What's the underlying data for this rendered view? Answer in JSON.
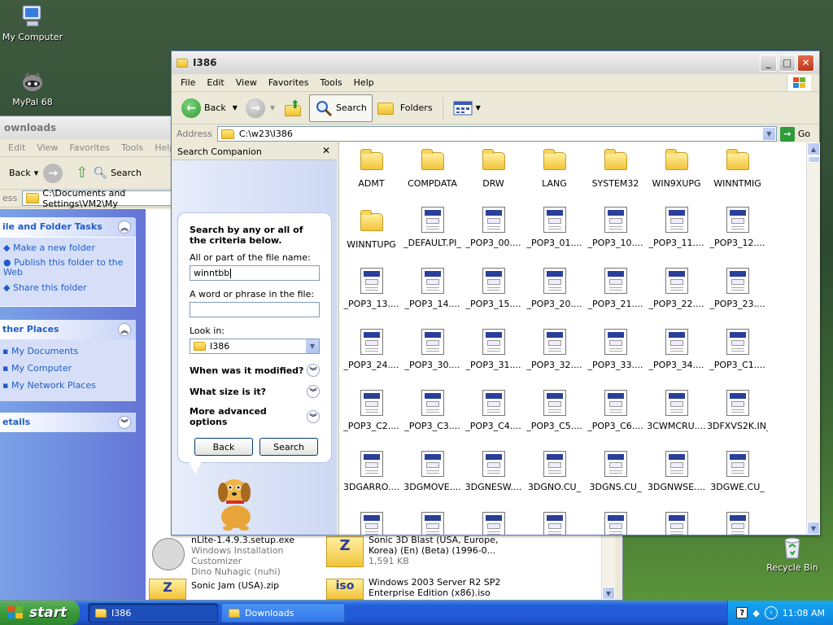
{
  "desktop": {
    "icons": [
      {
        "label": "My Computer"
      },
      {
        "label": "MyPal 68"
      },
      {
        "label": "Recycle Bin"
      }
    ]
  },
  "downloads_window": {
    "title": "ownloads",
    "menu": [
      "Edit",
      "View",
      "Favorites",
      "Tools",
      "Help"
    ],
    "toolbar": {
      "back": "Back",
      "search": "Search"
    },
    "address": "C:\\Documents and Settings\\VM2\\My",
    "address_label": "ess",
    "tasks": {
      "header": "ile and Folder Tasks",
      "items": [
        "Make a new folder",
        "Publish this folder to the Web",
        "Share this folder"
      ]
    },
    "other_places": {
      "header": "ther Places",
      "items": [
        "My Documents",
        "My Computer",
        "My Network Places"
      ]
    },
    "details": {
      "header": "etails"
    },
    "files": [
      {
        "name": "nLite-1.4.9.3.setup.exe",
        "line2": "Windows Installation Customizer",
        "line3": "Dino Nuhagic (nuhi)"
      },
      {
        "name": "Sonic 3D Blast (USA, Europe, Korea) (En) (Beta) (1996-0...",
        "line2": "",
        "line3": "1,591 KB"
      },
      {
        "name": "Sonic Jam (USA).zip",
        "line2": "",
        "line3": ""
      },
      {
        "name": "Windows 2003 Server R2 SP2 Enterprise Edition (x86).iso",
        "line2": "",
        "line3": ""
      }
    ]
  },
  "main_window": {
    "title": "I386",
    "menu": [
      "File",
      "Edit",
      "View",
      "Favorites",
      "Tools",
      "Help"
    ],
    "toolbar": {
      "back": "Back",
      "search": "Search",
      "folders": "Folders"
    },
    "address_label": "Address",
    "address": "C:\\w23\\I386",
    "go": "Go",
    "search_companion": {
      "title": "Search Companion",
      "heading": "Search by any or all of the criteria below.",
      "name_label": "All or part of the file name:",
      "name_value": "winntbb",
      "phrase_label": "A word or phrase in the file:",
      "phrase_value": "",
      "lookin_label": "Look in:",
      "lookin_value": "I386",
      "options": [
        "When was it modified?",
        "What size is it?",
        "More advanced options"
      ],
      "back_button": "Back",
      "search_button": "Search"
    },
    "items": [
      {
        "name": "ADMT",
        "type": "folder"
      },
      {
        "name": "COMPDATA",
        "type": "folder"
      },
      {
        "name": "DRW",
        "type": "folder"
      },
      {
        "name": "LANG",
        "type": "folder"
      },
      {
        "name": "SYSTEM32",
        "type": "folder"
      },
      {
        "name": "WIN9XUPG",
        "type": "folder"
      },
      {
        "name": "WINNTMIG",
        "type": "folder"
      },
      {
        "name": "WINNTUPG",
        "type": "folder"
      },
      {
        "name": "_DEFAULT.PI_",
        "type": "file"
      },
      {
        "name": "_POP3_00....",
        "type": "file"
      },
      {
        "name": "_POP3_01....",
        "type": "file"
      },
      {
        "name": "_POP3_10....",
        "type": "file"
      },
      {
        "name": "_POP3_11....",
        "type": "file"
      },
      {
        "name": "_POP3_12....",
        "type": "file"
      },
      {
        "name": "_POP3_13....",
        "type": "file"
      },
      {
        "name": "_POP3_14....",
        "type": "file"
      },
      {
        "name": "_POP3_15....",
        "type": "file"
      },
      {
        "name": "_POP3_20....",
        "type": "file"
      },
      {
        "name": "_POP3_21....",
        "type": "file"
      },
      {
        "name": "_POP3_22....",
        "type": "file"
      },
      {
        "name": "_POP3_23....",
        "type": "file"
      },
      {
        "name": "_POP3_24....",
        "type": "file"
      },
      {
        "name": "_POP3_30....",
        "type": "file"
      },
      {
        "name": "_POP3_31....",
        "type": "file"
      },
      {
        "name": "_POP3_32....",
        "type": "file"
      },
      {
        "name": "_POP3_33....",
        "type": "file"
      },
      {
        "name": "_POP3_34....",
        "type": "file"
      },
      {
        "name": "_POP3_C1....",
        "type": "file"
      },
      {
        "name": "_POP3_C2....",
        "type": "file"
      },
      {
        "name": "_POP3_C3....",
        "type": "file"
      },
      {
        "name": "_POP3_C4....",
        "type": "file"
      },
      {
        "name": "_POP3_C5....",
        "type": "file"
      },
      {
        "name": "_POP3_C6....",
        "type": "file"
      },
      {
        "name": "3CWMCRU....",
        "type": "file"
      },
      {
        "name": "3DFXVS2K.IN_",
        "type": "file"
      },
      {
        "name": "3DGARRO....",
        "type": "file"
      },
      {
        "name": "3DGMOVE....",
        "type": "file"
      },
      {
        "name": "3DGNESW....",
        "type": "file"
      },
      {
        "name": "3DGNO.CU_",
        "type": "file"
      },
      {
        "name": "3DGNS.CU_",
        "type": "file"
      },
      {
        "name": "3DGNWSE....",
        "type": "file"
      },
      {
        "name": "3DGWE.CU_",
        "type": "file"
      },
      {
        "name": "",
        "type": "file"
      },
      {
        "name": "",
        "type": "file"
      },
      {
        "name": "",
        "type": "file"
      },
      {
        "name": "",
        "type": "file"
      },
      {
        "name": "",
        "type": "file"
      },
      {
        "name": "",
        "type": "file"
      },
      {
        "name": "",
        "type": "file"
      }
    ]
  },
  "taskbar": {
    "start": "start",
    "buttons": [
      {
        "label": "I386",
        "active": true
      },
      {
        "label": "Downloads",
        "active": false
      }
    ],
    "clock": "11:08 AM"
  }
}
